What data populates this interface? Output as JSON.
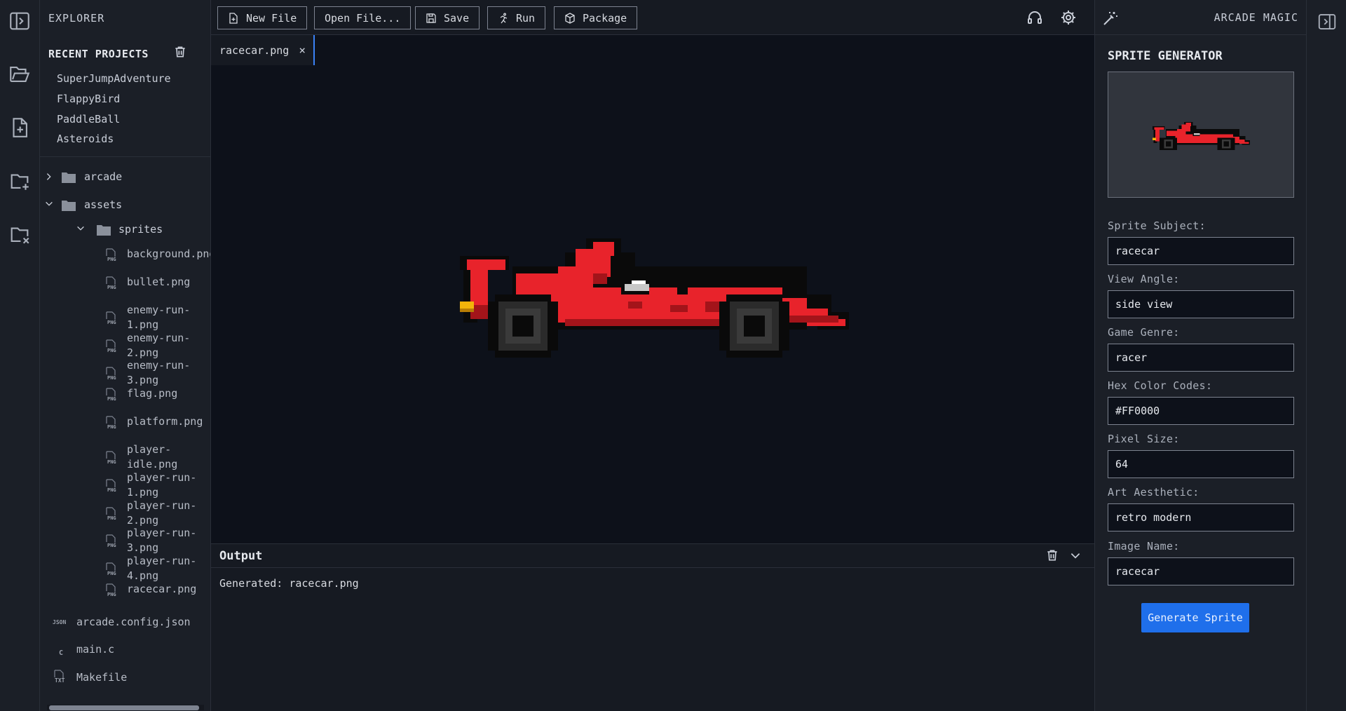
{
  "explorer": {
    "title": "EXPLORER",
    "recent_title": "RECENT PROJECTS",
    "recent_projects": [
      "SuperJumpAdventure",
      "FlappyBird",
      "PaddleBall",
      "Asteroids"
    ],
    "folders": {
      "arcade": "arcade",
      "assets": "assets",
      "sprites": "sprites"
    },
    "sprite_files": [
      [
        "background.png"
      ],
      [
        "bullet.png"
      ],
      [
        "enemy-run-",
        "1.png"
      ],
      [
        "enemy-run-",
        "2.png"
      ],
      [
        "enemy-run-",
        "3.png"
      ],
      [
        "flag.png"
      ],
      [
        "platform.png"
      ],
      [
        "player-",
        "idle.png"
      ],
      [
        "player-run-",
        "1.png"
      ],
      [
        "player-run-",
        "2.png"
      ],
      [
        "player-run-",
        "3.png"
      ],
      [
        "player-run-",
        "4.png"
      ],
      [
        "racecar.png"
      ]
    ],
    "root_files": [
      {
        "name": "arcade.config.json",
        "tag": "JSON"
      },
      {
        "name": "main.c",
        "tag": "C"
      },
      {
        "name": "Makefile",
        "tag": "TXT"
      }
    ],
    "file_tag": "PNG"
  },
  "toolbar": {
    "new_file": "New File",
    "open_file": "Open File...",
    "save": "Save",
    "run": "Run",
    "package": "Package"
  },
  "tabs": [
    {
      "label": "racecar.png",
      "close": "×"
    }
  ],
  "output": {
    "title": "Output",
    "text": "Generated: racecar.png"
  },
  "right_panel": {
    "title": "ARCADE MAGIC",
    "section_title": "SPRITE GENERATOR",
    "fields": [
      {
        "label": "Sprite Subject:",
        "value": "racecar"
      },
      {
        "label": "View Angle:",
        "value": "side view"
      },
      {
        "label": "Game Genre:",
        "value": "racer"
      },
      {
        "label": "Hex Color Codes:",
        "value": "#FF0000"
      },
      {
        "label": "Pixel Size:",
        "value": "64"
      },
      {
        "label": "Art Aesthetic:",
        "value": "retro modern"
      },
      {
        "label": "Image Name:",
        "value": "racecar"
      }
    ],
    "generate_label": "Generate Sprite"
  },
  "colors": {
    "accent": "#1f6feb",
    "tab_indicator": "#3b82f6",
    "car_red": "#e8232b",
    "car_dark_red": "#a3141a"
  },
  "icons": {
    "left_bar": [
      "toggle-sidebar-icon",
      "open-folder-icon",
      "new-file-icon",
      "new-folder-icon",
      "close-folder-icon"
    ],
    "toolbar_right": [
      "headphones-icon",
      "gear-icon"
    ],
    "right_bar": [
      "toggle-right-panel-icon"
    ]
  }
}
